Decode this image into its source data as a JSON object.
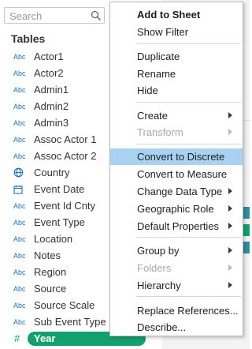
{
  "search": {
    "placeholder": "Search"
  },
  "tables_title": "Tables",
  "fields": [
    {
      "type": "Abc",
      "label": "Actor1"
    },
    {
      "type": "Abc",
      "label": "Actor2"
    },
    {
      "type": "Abc",
      "label": "Admin1"
    },
    {
      "type": "Abc",
      "label": "Admin2"
    },
    {
      "type": "Abc",
      "label": "Admin3"
    },
    {
      "type": "Abc",
      "label": "Assoc Actor 1"
    },
    {
      "type": "Abc",
      "label": "Assoc Actor 2"
    },
    {
      "type": "globe",
      "label": "Country"
    },
    {
      "type": "calendar",
      "label": "Event Date"
    },
    {
      "type": "Abc",
      "label": "Event Id Cnty"
    },
    {
      "type": "Abc",
      "label": "Event Type"
    },
    {
      "type": "Abc",
      "label": "Location"
    },
    {
      "type": "Abc",
      "label": "Notes"
    },
    {
      "type": "Abc",
      "label": "Region"
    },
    {
      "type": "Abc",
      "label": "Source"
    },
    {
      "type": "Abc",
      "label": "Source Scale"
    },
    {
      "type": "Abc",
      "label": "Sub Event Type"
    },
    {
      "type": "#",
      "label": "Year"
    }
  ],
  "menu": {
    "add_to_sheet": "Add to Sheet",
    "show_filter": "Show Filter",
    "duplicate": "Duplicate",
    "rename": "Rename",
    "hide": "Hide",
    "create": "Create",
    "transform": "Transform",
    "convert_to_discrete": "Convert to Discrete",
    "convert_to_measure": "Convert to Measure",
    "change_data_type": "Change Data Type",
    "geographic_role": "Geographic Role",
    "default_properties": "Default Properties",
    "group_by": "Group by",
    "folders": "Folders",
    "hierarchy": "Hierarchy",
    "replace_references": "Replace References...",
    "describe": "Describe..."
  },
  "colors": {
    "selected_pill": "#13a06e",
    "menu_highlight": "#a9d1f2",
    "type_icon": "#1f6fb2"
  }
}
